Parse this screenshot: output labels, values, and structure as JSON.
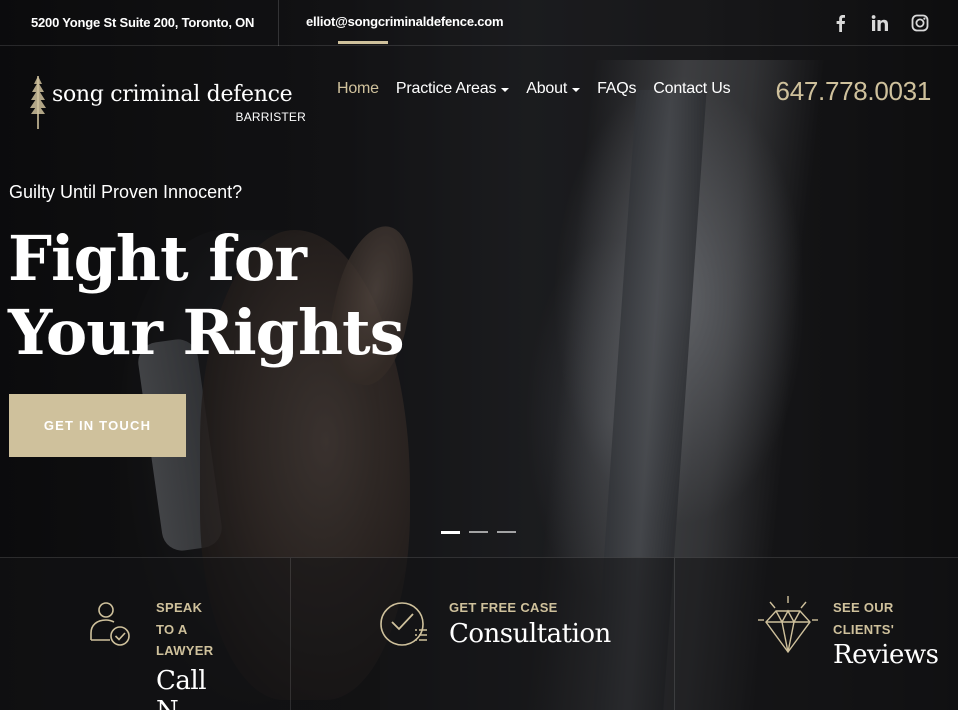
{
  "topbar": {
    "address": "5200 Yonge St Suite 200, Toronto, ON",
    "email": "elliot@songcriminaldefence.com",
    "social": [
      {
        "icon": "facebook-icon",
        "glyph": "f"
      },
      {
        "icon": "linkedin-icon",
        "glyph": "in"
      },
      {
        "icon": "instagram-icon",
        "glyph": ""
      }
    ]
  },
  "header": {
    "logo_name": "song criminal defence",
    "logo_sub": "BARRISTER",
    "nav": [
      {
        "label": "Home",
        "active": true,
        "dropdown": false
      },
      {
        "label": "Practice Areas",
        "active": false,
        "dropdown": true
      },
      {
        "label": "About",
        "active": false,
        "dropdown": true
      },
      {
        "label": "FAQs",
        "active": false,
        "dropdown": false
      },
      {
        "label": "Contact Us",
        "active": false,
        "dropdown": false
      }
    ],
    "phone": "647.778.0031"
  },
  "hero": {
    "tagline": "Guilty Until Proven Innocent?",
    "headline_line1": "Fight for",
    "headline_line2": "Your Rights",
    "cta_label": "GET IN TOUCH",
    "slides_total": 3,
    "slides_active": 1
  },
  "features": [
    {
      "icon": "lawyer-check-icon",
      "eyebrow": [
        "SPEAK",
        "TO A",
        "LAWYER"
      ],
      "big": [
        "Call",
        "N"
      ]
    },
    {
      "icon": "checklist-icon",
      "eyebrow": [
        "GET FREE CASE"
      ],
      "big": [
        "Consultation"
      ]
    },
    {
      "icon": "diamond-icon",
      "eyebrow": [
        "SEE OUR",
        "CLIENTS'"
      ],
      "big": [
        "Reviews"
      ]
    }
  ],
  "colors": {
    "accent": "#cfc19c",
    "text": "#ffffff"
  }
}
